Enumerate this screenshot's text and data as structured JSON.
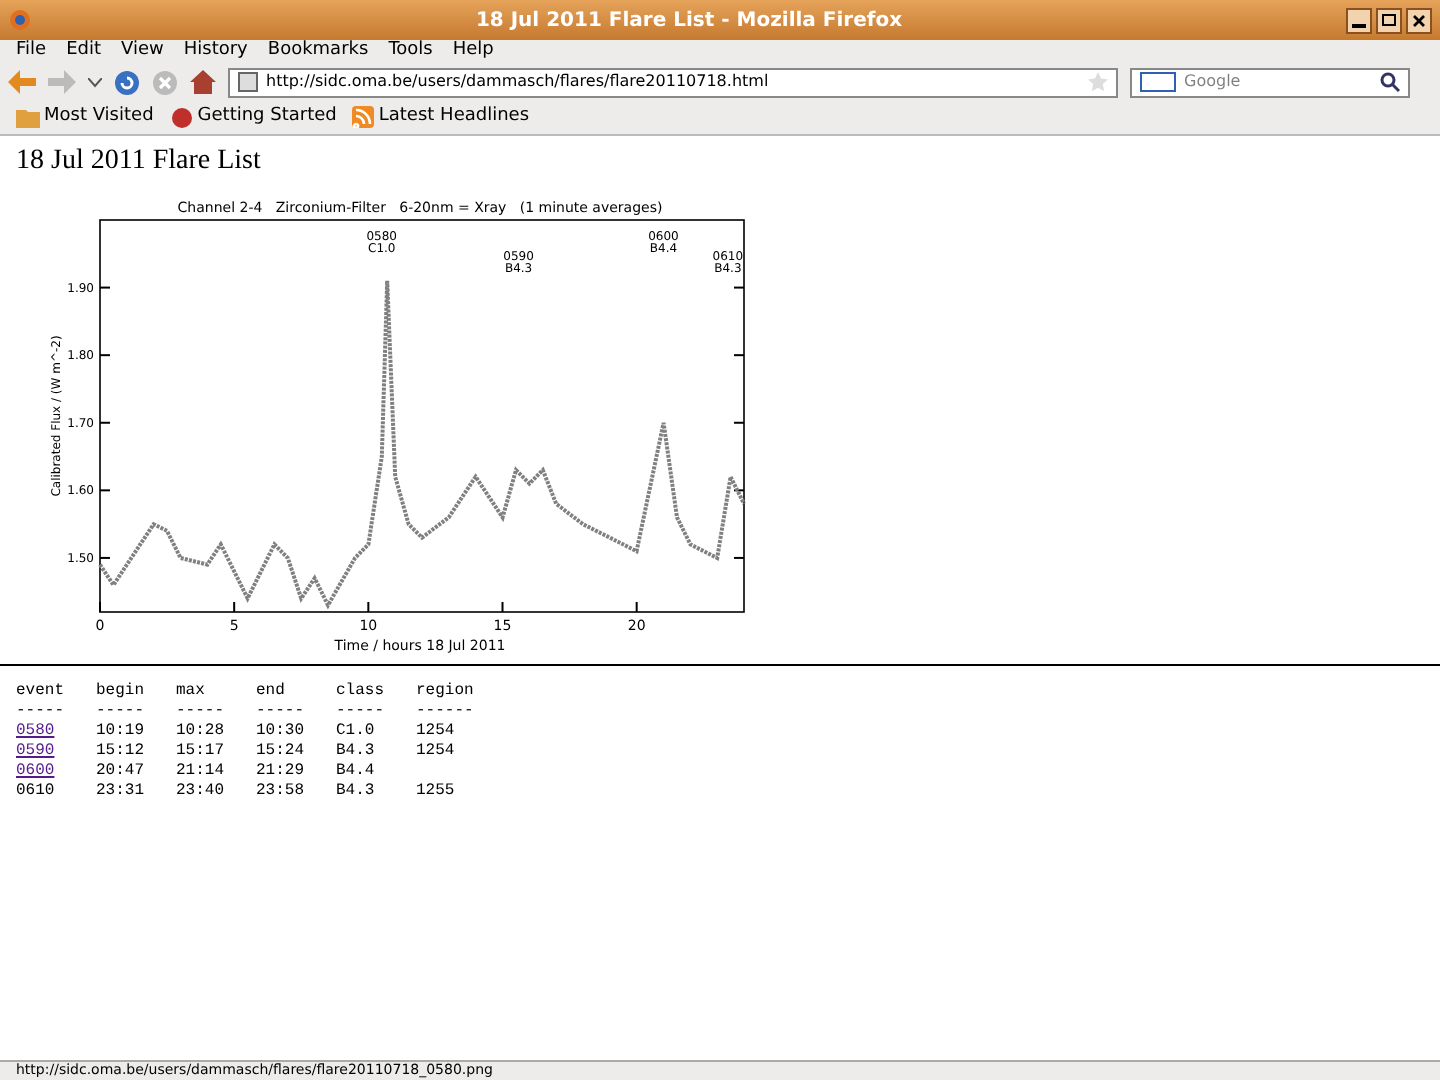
{
  "window": {
    "title": "18 Jul 2011 Flare List - Mozilla Firefox"
  },
  "menu": [
    "File",
    "Edit",
    "View",
    "History",
    "Bookmarks",
    "Tools",
    "Help"
  ],
  "address": {
    "value": "http://sidc.oma.be/users/dammasch/flares/flare20110718.html"
  },
  "search": {
    "placeholder": "Google"
  },
  "bookmarks": [
    {
      "label": "Most Visited",
      "kind": "folder"
    },
    {
      "label": "Getting Started",
      "kind": "page"
    },
    {
      "label": "Latest Headlines",
      "kind": "feed"
    }
  ],
  "page": {
    "heading": "18 Jul 2011 Flare List",
    "chart_data": {
      "type": "line",
      "title": "Channel 2-4   Zirconium-Filter   6-20nm = Xray   (1 minute averages)",
      "xlabel": "Time / hours 18 Jul 2011",
      "ylabel": "Calibrated Flux / (W m^-2)",
      "xlim": [
        0,
        24
      ],
      "ylim": [
        1.42,
        2.0
      ],
      "xticks": [
        0,
        5,
        10,
        15,
        20
      ],
      "yticks": [
        {
          "value": 1.5,
          "label": "1.50"
        },
        {
          "value": 1.6,
          "label": "1.60"
        },
        {
          "value": 1.7,
          "label": "1.70"
        },
        {
          "value": 1.8,
          "label": "1.80"
        },
        {
          "value": 1.9,
          "label": "1.90"
        }
      ],
      "x": [
        0,
        0.5,
        1.5,
        2,
        2.5,
        3,
        4,
        4.5,
        5.5,
        6.5,
        7,
        7.5,
        8,
        8.5,
        9.5,
        10,
        10.5,
        10.7,
        11,
        11.5,
        12,
        13,
        14,
        15,
        15.5,
        16,
        16.5,
        17,
        18,
        19,
        20,
        21,
        21.5,
        22,
        22.5,
        23,
        23.5,
        24
      ],
      "series": [
        {
          "color": "#808080",
          "line_style": "dotted",
          "values": [
            1.49,
            1.46,
            1.52,
            1.55,
            1.54,
            1.5,
            1.49,
            1.52,
            1.44,
            1.52,
            1.5,
            1.44,
            1.47,
            1.43,
            1.5,
            1.52,
            1.65,
            1.91,
            1.62,
            1.55,
            1.53,
            1.56,
            1.62,
            1.56,
            1.63,
            1.61,
            1.63,
            1.58,
            1.55,
            1.53,
            1.51,
            1.7,
            1.56,
            1.52,
            1.51,
            1.5,
            1.62,
            1.58
          ]
        }
      ]
    },
    "flare_labels": [
      {
        "event": "0580",
        "class": "C1.0"
      },
      {
        "event": "0590",
        "class": "B4.3"
      },
      {
        "event": "0600",
        "class": "B4.4"
      },
      {
        "event": "0610",
        "class": "B4.3"
      }
    ],
    "table": {
      "columns": [
        "event",
        "begin",
        "max",
        "end",
        "class",
        "region"
      ],
      "divider": [
        "-----",
        "-----",
        "-----",
        "-----",
        "-----",
        "------"
      ],
      "rows": [
        {
          "link": true,
          "cells": [
            "0580",
            "10:19",
            "10:28",
            "10:30",
            "C1.0",
            "1254"
          ]
        },
        {
          "link": true,
          "cells": [
            "0590",
            "15:12",
            "15:17",
            "15:24",
            "B4.3",
            "1254"
          ]
        },
        {
          "link": true,
          "cells": [
            "0600",
            "20:47",
            "21:14",
            "21:29",
            "B4.4",
            ""
          ]
        },
        {
          "link": false,
          "cells": [
            "0610",
            "23:31",
            "23:40",
            "23:58",
            "B4.3",
            "1255"
          ]
        }
      ]
    }
  },
  "status_bar": "http://sidc.oma.be/users/dammasch/flares/flare20110718_0580.png"
}
